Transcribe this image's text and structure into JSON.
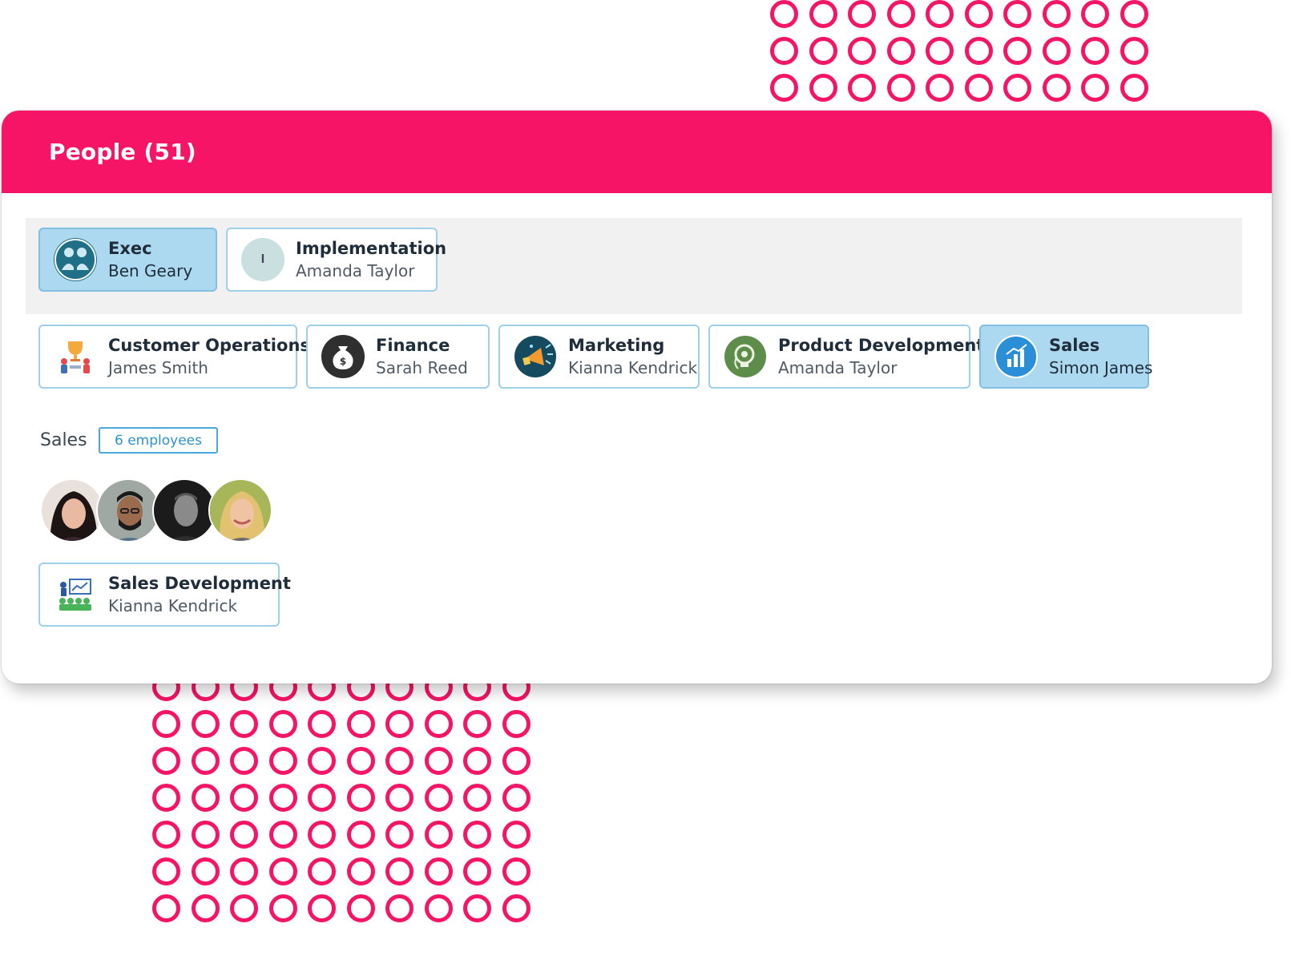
{
  "colors": {
    "brand": "#f51465",
    "active_card": "#acd9f0",
    "card_border": "#9fd0ea",
    "badge": "#2b94d0"
  },
  "header": {
    "title": "People (51)"
  },
  "top_teams": [
    {
      "name": "Exec",
      "lead": "Ben Geary",
      "icon": "exec-team-icon",
      "active": true
    },
    {
      "name": "Implementation",
      "lead": "Amanda Taylor",
      "icon": "initial-avatar",
      "initial": "I",
      "active": false
    }
  ],
  "departments": [
    {
      "name": "Customer Operations",
      "lead": "James Smith",
      "icon": "trophy-team-icon"
    },
    {
      "name": "Finance",
      "lead": "Sarah Reed",
      "icon": "money-bag-icon"
    },
    {
      "name": "Marketing",
      "lead": "Kianna Kendrick",
      "icon": "megaphone-icon"
    },
    {
      "name": "Product Development",
      "lead": "Amanda Taylor",
      "icon": "lightbulb-gear-icon"
    },
    {
      "name": "Sales",
      "lead": "Simon James",
      "icon": "growth-chart-icon",
      "active": true
    }
  ],
  "selected_section": {
    "label": "Sales",
    "count_badge": "6 employees",
    "avatars": [
      "employee-avatar-1",
      "employee-avatar-2",
      "employee-avatar-3",
      "employee-avatar-4"
    ]
  },
  "sub_teams": [
    {
      "name": "Sales Development",
      "lead": "Kianna Kendrick",
      "icon": "presentation-team-icon"
    }
  ]
}
